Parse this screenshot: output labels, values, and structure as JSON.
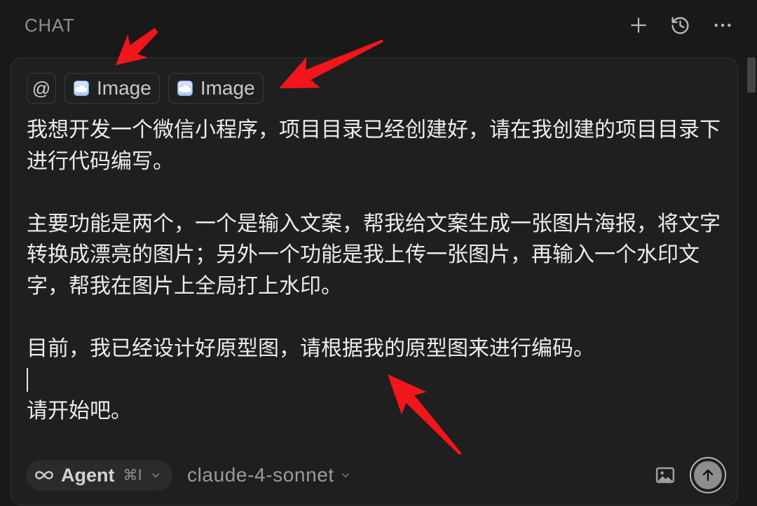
{
  "header": {
    "title": "CHAT"
  },
  "context": {
    "pills": [
      {
        "label": "@"
      },
      {
        "label": "Image"
      },
      {
        "label": "Image"
      }
    ]
  },
  "message": {
    "lines": [
      "我想开发一个微信小程序，项目目录已经创建好，请在我创建的项目目录下",
      "进行代码编写。",
      "",
      "主要功能是两个，一个是输入文案，帮我给文案生成一张图片海报，将文字",
      "转换成漂亮的图片；另外一个功能是我上传一张图片，再输入一个水印文",
      "字，帮我在图片上全局打上水印。",
      "",
      "目前，我已经设计好原型图，请根据我的原型图来进行编码。",
      "",
      "请开始吧。"
    ]
  },
  "footer": {
    "mode": {
      "label": "Agent",
      "shortcut": "⌘I"
    },
    "model": {
      "label": "claude-4-sonnet"
    }
  },
  "icons": {
    "new_chat": "plus-icon",
    "history": "history-icon",
    "more": "more-icon",
    "context_image": "image-thumbnail-icon",
    "mode": "infinity-icon",
    "dropdown": "chevron-down-icon",
    "attach_image": "image-icon",
    "send": "arrow-up-icon"
  },
  "colors": {
    "annotation_arrow": "#f2151b"
  }
}
